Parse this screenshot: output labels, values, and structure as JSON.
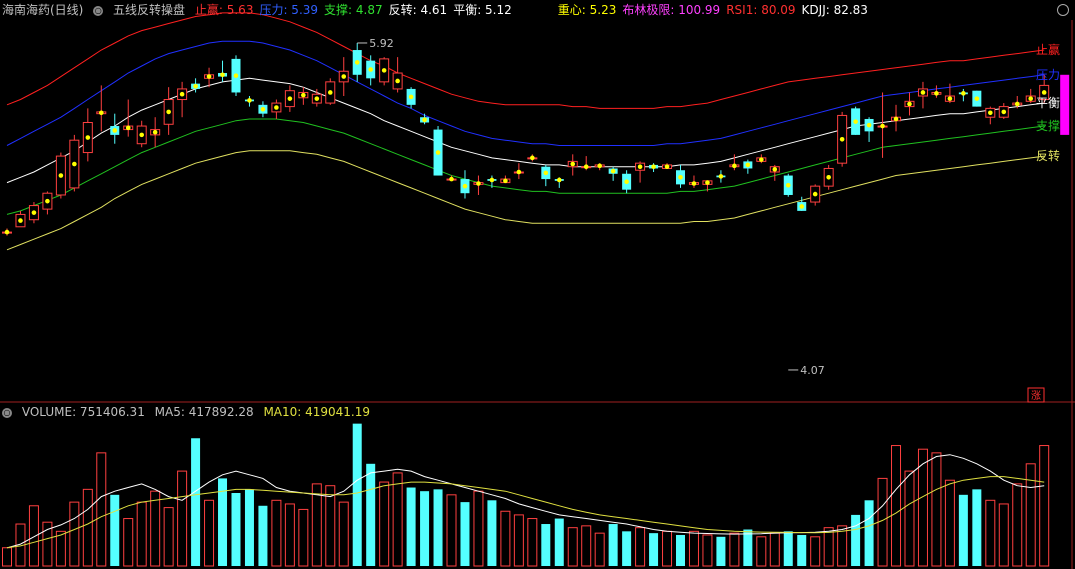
{
  "header": {
    "stock_name": "海南海药(日线)",
    "indicator_name": "五线反转操盘",
    "items": [
      {
        "label": "止赢:",
        "value": "5.63",
        "color": "#ff3030"
      },
      {
        "label": "压力:",
        "value": "5.39",
        "color": "#3060ff"
      },
      {
        "label": "支撑:",
        "value": "4.87",
        "color": "#30e030"
      },
      {
        "label": "反转:",
        "value": "4.61",
        "color": "#ffffff"
      },
      {
        "label": "平衡:",
        "value": "5.12",
        "color": "#ffffff"
      }
    ],
    "items2": [
      {
        "label": "重心:",
        "value": "5.23",
        "color": "#ffff00"
      },
      {
        "label": "布林极限:",
        "value": "100.99",
        "color": "#ff40ff"
      },
      {
        "label": "RSI1:",
        "value": "80.09",
        "color": "#ff3030"
      },
      {
        "label": "KDJJ:",
        "value": "82.83",
        "color": "#ffffff"
      }
    ]
  },
  "volume_header": {
    "volume": "VOLUME: 751406.31",
    "ma5": "MA5: 417892.28",
    "ma10": "MA10: 419041.19"
  },
  "colors": {
    "up": "#ff4040",
    "down": "#54ffff",
    "zhiying": "#ff2020",
    "yali": "#2030ff",
    "pingheng": "#ffffff",
    "zhicheng": "#20c020",
    "fanzhuan": "#e0e060",
    "ma5": "#ffffff",
    "ma10": "#e0e040",
    "bull": "#ff00ff",
    "dot": "#ffff00"
  },
  "chart_data": [
    {
      "type": "candlestick",
      "ylim": [
        3.9,
        6.05
      ],
      "candles": [
        [
          4.85,
          4.87,
          4.83,
          4.85
        ],
        [
          4.88,
          4.97,
          4.88,
          4.95
        ],
        [
          4.92,
          5.02,
          4.9,
          5.0
        ],
        [
          4.98,
          5.08,
          4.95,
          5.07
        ],
        [
          5.06,
          5.3,
          5.04,
          5.28
        ],
        [
          5.1,
          5.4,
          5.08,
          5.37
        ],
        [
          5.3,
          5.55,
          5.25,
          5.47
        ],
        [
          5.52,
          5.68,
          5.42,
          5.53
        ],
        [
          5.45,
          5.52,
          5.35,
          5.4
        ],
        [
          5.43,
          5.6,
          5.39,
          5.45
        ],
        [
          5.35,
          5.48,
          5.33,
          5.45
        ],
        [
          5.4,
          5.5,
          5.33,
          5.43
        ],
        [
          5.46,
          5.67,
          5.4,
          5.6
        ],
        [
          5.6,
          5.7,
          5.5,
          5.66
        ],
        [
          5.69,
          5.72,
          5.64,
          5.66
        ],
        [
          5.72,
          5.78,
          5.67,
          5.74
        ],
        [
          5.75,
          5.82,
          5.7,
          5.73
        ],
        [
          5.83,
          5.85,
          5.62,
          5.64
        ],
        [
          5.6,
          5.62,
          5.56,
          5.59
        ],
        [
          5.57,
          5.59,
          5.5,
          5.52
        ],
        [
          5.53,
          5.6,
          5.49,
          5.58
        ],
        [
          5.56,
          5.68,
          5.53,
          5.65
        ],
        [
          5.61,
          5.67,
          5.57,
          5.64
        ],
        [
          5.58,
          5.66,
          5.56,
          5.63
        ],
        [
          5.58,
          5.72,
          5.57,
          5.7
        ],
        [
          5.7,
          5.84,
          5.62,
          5.76
        ],
        [
          5.88,
          5.92,
          5.7,
          5.74
        ],
        [
          5.82,
          5.85,
          5.68,
          5.72
        ],
        [
          5.7,
          5.84,
          5.68,
          5.83
        ],
        [
          5.66,
          5.84,
          5.64,
          5.75
        ],
        [
          5.66,
          5.67,
          5.55,
          5.57
        ],
        [
          5.5,
          5.52,
          5.46,
          5.47
        ],
        [
          5.43,
          5.45,
          5.17,
          5.17
        ],
        [
          5.15,
          5.17,
          5.14,
          5.15
        ],
        [
          5.15,
          5.2,
          5.04,
          5.07
        ],
        [
          5.12,
          5.17,
          5.06,
          5.13
        ],
        [
          5.15,
          5.17,
          5.1,
          5.14
        ],
        [
          5.13,
          5.17,
          5.13,
          5.15
        ],
        [
          5.19,
          5.24,
          5.15,
          5.19
        ],
        [
          5.27,
          5.29,
          5.25,
          5.27
        ],
        [
          5.22,
          5.23,
          5.11,
          5.15
        ],
        [
          5.15,
          5.16,
          5.1,
          5.14
        ],
        [
          5.22,
          5.29,
          5.17,
          5.25
        ],
        [
          5.22,
          5.28,
          5.2,
          5.22
        ],
        [
          5.22,
          5.24,
          5.2,
          5.23
        ],
        [
          5.21,
          5.22,
          5.14,
          5.18
        ],
        [
          5.18,
          5.2,
          5.07,
          5.09
        ],
        [
          5.2,
          5.25,
          5.13,
          5.24
        ],
        [
          5.23,
          5.24,
          5.19,
          5.21
        ],
        [
          5.21,
          5.24,
          5.21,
          5.23
        ],
        [
          5.2,
          5.23,
          5.1,
          5.12
        ],
        [
          5.12,
          5.17,
          5.1,
          5.13
        ],
        [
          5.12,
          5.14,
          5.08,
          5.14
        ],
        [
          5.17,
          5.2,
          5.13,
          5.16
        ],
        [
          5.22,
          5.29,
          5.2,
          5.23
        ],
        [
          5.25,
          5.26,
          5.18,
          5.21
        ],
        [
          5.25,
          5.29,
          5.24,
          5.27
        ],
        [
          5.19,
          5.23,
          5.14,
          5.22
        ],
        [
          5.17,
          5.18,
          5.05,
          5.06
        ],
        [
          5.02,
          5.05,
          4.97,
          4.97
        ],
        [
          5.02,
          5.12,
          5.0,
          5.11
        ],
        [
          5.11,
          5.23,
          5.09,
          5.21
        ],
        [
          5.24,
          5.53,
          5.22,
          5.51
        ],
        [
          5.55,
          5.56,
          5.4,
          5.4
        ],
        [
          5.49,
          5.5,
          5.36,
          5.42
        ],
        [
          5.45,
          5.64,
          5.27,
          5.45
        ],
        [
          5.48,
          5.57,
          5.42,
          5.5
        ],
        [
          5.56,
          5.64,
          5.51,
          5.59
        ],
        [
          5.62,
          5.7,
          5.55,
          5.66
        ],
        [
          5.63,
          5.68,
          5.61,
          5.64
        ],
        [
          5.59,
          5.69,
          5.58,
          5.62
        ],
        [
          5.64,
          5.66,
          5.59,
          5.63
        ],
        [
          5.65,
          5.65,
          5.56,
          5.56
        ],
        [
          5.5,
          5.56,
          5.46,
          5.55
        ],
        [
          5.5,
          5.58,
          5.49,
          5.56
        ],
        [
          5.57,
          5.62,
          5.55,
          5.58
        ],
        [
          5.59,
          5.66,
          5.58,
          5.62
        ],
        [
          5.6,
          5.74,
          5.58,
          5.68
        ]
      ],
      "bands": {
        "zhiying": [
          5.57,
          5.6,
          5.64,
          5.68,
          5.73,
          5.78,
          5.83,
          5.88,
          5.92,
          5.96,
          5.99,
          6.01,
          6.03,
          6.05,
          6.07,
          6.08,
          6.09,
          6.09,
          6.09,
          6.08,
          6.06,
          6.04,
          6.01,
          5.98,
          5.94,
          5.9,
          5.86,
          5.82,
          5.79,
          5.75,
          5.72,
          5.69,
          5.66,
          5.63,
          5.61,
          5.59,
          5.58,
          5.57,
          5.57,
          5.57,
          5.57,
          5.57,
          5.56,
          5.56,
          5.55,
          5.55,
          5.55,
          5.55,
          5.55,
          5.56,
          5.56,
          5.57,
          5.58,
          5.6,
          5.62,
          5.64,
          5.66,
          5.68,
          5.7,
          5.71,
          5.72,
          5.73,
          5.74,
          5.75,
          5.76,
          5.77,
          5.78,
          5.79,
          5.8,
          5.81,
          5.82,
          5.82,
          5.83,
          5.84,
          5.85,
          5.86,
          5.87,
          5.88
        ],
        "yali": [
          5.34,
          5.38,
          5.42,
          5.46,
          5.5,
          5.55,
          5.6,
          5.65,
          5.7,
          5.75,
          5.79,
          5.83,
          5.86,
          5.88,
          5.9,
          5.92,
          5.93,
          5.93,
          5.93,
          5.92,
          5.9,
          5.88,
          5.85,
          5.82,
          5.78,
          5.74,
          5.7,
          5.66,
          5.62,
          5.58,
          5.55,
          5.51,
          5.48,
          5.45,
          5.42,
          5.4,
          5.38,
          5.37,
          5.36,
          5.35,
          5.35,
          5.34,
          5.34,
          5.34,
          5.34,
          5.34,
          5.34,
          5.34,
          5.34,
          5.35,
          5.35,
          5.36,
          5.37,
          5.38,
          5.4,
          5.42,
          5.44,
          5.46,
          5.48,
          5.5,
          5.52,
          5.54,
          5.56,
          5.58,
          5.6,
          5.62,
          5.63,
          5.64,
          5.65,
          5.66,
          5.67,
          5.68,
          5.69,
          5.7,
          5.71,
          5.72,
          5.73,
          5.74
        ],
        "pingheng": [
          5.13,
          5.16,
          5.19,
          5.23,
          5.27,
          5.31,
          5.36,
          5.41,
          5.45,
          5.5,
          5.54,
          5.57,
          5.6,
          5.63,
          5.66,
          5.68,
          5.7,
          5.71,
          5.72,
          5.71,
          5.7,
          5.69,
          5.67,
          5.64,
          5.61,
          5.58,
          5.55,
          5.52,
          5.48,
          5.45,
          5.42,
          5.39,
          5.36,
          5.33,
          5.31,
          5.29,
          5.27,
          5.26,
          5.25,
          5.24,
          5.23,
          5.23,
          5.22,
          5.22,
          5.22,
          5.22,
          5.22,
          5.22,
          5.22,
          5.22,
          5.23,
          5.23,
          5.24,
          5.25,
          5.27,
          5.29,
          5.31,
          5.33,
          5.35,
          5.37,
          5.39,
          5.41,
          5.43,
          5.45,
          5.46,
          5.47,
          5.48,
          5.49,
          5.5,
          5.51,
          5.52,
          5.52,
          5.53,
          5.54,
          5.55,
          5.56,
          5.57,
          5.58
        ],
        "zhicheng": [
          4.95,
          4.97,
          5.0,
          5.03,
          5.06,
          5.1,
          5.14,
          5.18,
          5.22,
          5.26,
          5.3,
          5.33,
          5.36,
          5.39,
          5.42,
          5.44,
          5.46,
          5.48,
          5.49,
          5.49,
          5.49,
          5.48,
          5.47,
          5.45,
          5.43,
          5.41,
          5.38,
          5.35,
          5.32,
          5.29,
          5.26,
          5.23,
          5.2,
          5.17,
          5.15,
          5.13,
          5.11,
          5.1,
          5.09,
          5.08,
          5.08,
          5.07,
          5.07,
          5.07,
          5.07,
          5.07,
          5.07,
          5.07,
          5.07,
          5.07,
          5.08,
          5.08,
          5.09,
          5.1,
          5.11,
          5.13,
          5.15,
          5.17,
          5.19,
          5.21,
          5.23,
          5.25,
          5.27,
          5.29,
          5.31,
          5.33,
          5.34,
          5.35,
          5.36,
          5.37,
          5.38,
          5.39,
          5.4,
          5.41,
          5.42,
          5.43,
          5.44,
          5.45
        ],
        "fanzhuan": [
          4.75,
          4.78,
          4.81,
          4.84,
          4.87,
          4.91,
          4.95,
          4.99,
          5.04,
          5.08,
          5.12,
          5.15,
          5.18,
          5.21,
          5.24,
          5.26,
          5.28,
          5.3,
          5.31,
          5.31,
          5.31,
          5.31,
          5.3,
          5.29,
          5.27,
          5.25,
          5.22,
          5.19,
          5.16,
          5.13,
          5.1,
          5.07,
          5.04,
          5.01,
          4.98,
          4.96,
          4.94,
          4.92,
          4.91,
          4.9,
          4.9,
          4.9,
          4.9,
          4.9,
          4.9,
          4.9,
          4.9,
          4.9,
          4.9,
          4.9,
          4.9,
          4.91,
          4.91,
          4.92,
          4.93,
          4.95,
          4.97,
          4.99,
          5.01,
          5.03,
          5.05,
          5.07,
          5.09,
          5.11,
          5.13,
          5.15,
          5.17,
          5.18,
          5.19,
          5.2,
          5.21,
          5.22,
          5.23,
          5.24,
          5.25,
          5.26,
          5.27,
          5.28
        ]
      },
      "annotations": [
        {
          "text": "5.92",
          "index": 26,
          "value": 5.92
        },
        {
          "text": "4.07",
          "index": 58,
          "value": 4.07
        }
      ],
      "right_labels": [
        "止赢",
        "压力",
        "平衡",
        "支撑",
        "反转"
      ],
      "corner_badge": "涨"
    },
    {
      "type": "bar",
      "title": "VOLUME",
      "volumes": [
        100,
        230,
        330,
        240,
        190,
        350,
        420,
        620,
        390,
        260,
        350,
        410,
        320,
        520,
        700,
        360,
        480,
        400,
        420,
        330,
        360,
        340,
        310,
        450,
        440,
        350,
        780,
        560,
        460,
        510,
        430,
        410,
        420,
        390,
        350,
        410,
        360,
        300,
        280,
        260,
        230,
        260,
        210,
        220,
        180,
        230,
        190,
        210,
        180,
        190,
        170,
        190,
        170,
        160,
        180,
        200,
        160,
        180,
        190,
        170,
        160,
        210,
        220,
        280,
        360,
        480,
        660,
        520,
        640,
        620,
        470,
        390,
        420,
        360,
        340,
        450,
        560,
        660
      ],
      "ma5": [
        100,
        120,
        160,
        200,
        225,
        260,
        310,
        380,
        410,
        430,
        450,
        420,
        380,
        360,
        410,
        460,
        500,
        520,
        500,
        480,
        430,
        410,
        400,
        390,
        380,
        410,
        470,
        510,
        520,
        530,
        520,
        490,
        470,
        450,
        430,
        410,
        390,
        370,
        340,
        320,
        300,
        280,
        270,
        260,
        250,
        240,
        230,
        215,
        200,
        190,
        185,
        180,
        178,
        176,
        175,
        176,
        177,
        180,
        182,
        183,
        185,
        190,
        200,
        220,
        260,
        330,
        420,
        500,
        560,
        600,
        610,
        590,
        560,
        520,
        470,
        440,
        430,
        440
      ],
      "ma10": [
        100,
        110,
        130,
        150,
        170,
        200,
        230,
        270,
        300,
        330,
        350,
        360,
        370,
        380,
        390,
        400,
        410,
        420,
        420,
        415,
        410,
        405,
        400,
        395,
        390,
        390,
        400,
        420,
        440,
        450,
        460,
        460,
        455,
        450,
        440,
        430,
        420,
        410,
        390,
        370,
        350,
        330,
        310,
        295,
        280,
        270,
        260,
        250,
        240,
        230,
        220,
        210,
        200,
        195,
        190,
        188,
        186,
        185,
        184,
        183,
        182,
        184,
        190,
        200,
        220,
        250,
        290,
        340,
        380,
        420,
        450,
        470,
        480,
        490,
        490,
        480,
        470,
        460
      ]
    }
  ]
}
